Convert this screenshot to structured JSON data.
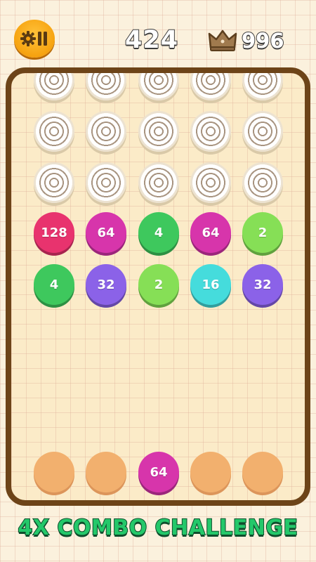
{
  "header": {
    "score": "424",
    "best_score": "996",
    "settings_icon": "gear-pause-icon",
    "best_icon": "crown-icon"
  },
  "board": {
    "ring_rows": 3,
    "ring_cols": 5,
    "grid": [
      [
        {
          "label": "128",
          "color": "#e8336e"
        },
        {
          "label": "64",
          "color": "#d735ab"
        },
        {
          "label": "4",
          "color": "#3ec85d"
        },
        {
          "label": "64",
          "color": "#d735ab"
        },
        {
          "label": "2",
          "color": "#86df56"
        }
      ],
      [
        {
          "label": "4",
          "color": "#3ec85d"
        },
        {
          "label": "32",
          "color": "#8b62e8"
        },
        {
          "label": "2",
          "color": "#86df56"
        },
        {
          "label": "16",
          "color": "#45dcdc"
        },
        {
          "label": "32",
          "color": "#8b62e8"
        }
      ]
    ],
    "launch_slots": [
      {
        "label": ""
      },
      {
        "label": ""
      },
      {
        "label": "64",
        "color": "#d735ab"
      },
      {
        "label": ""
      },
      {
        "label": ""
      }
    ]
  },
  "banner": {
    "text": "4X COMBO CHALLENGE",
    "color": "#24c86a"
  },
  "colors": {
    "board_border": "#6d4418",
    "slot_empty": "#f2b06e",
    "settings_button": "#f6a20f"
  }
}
